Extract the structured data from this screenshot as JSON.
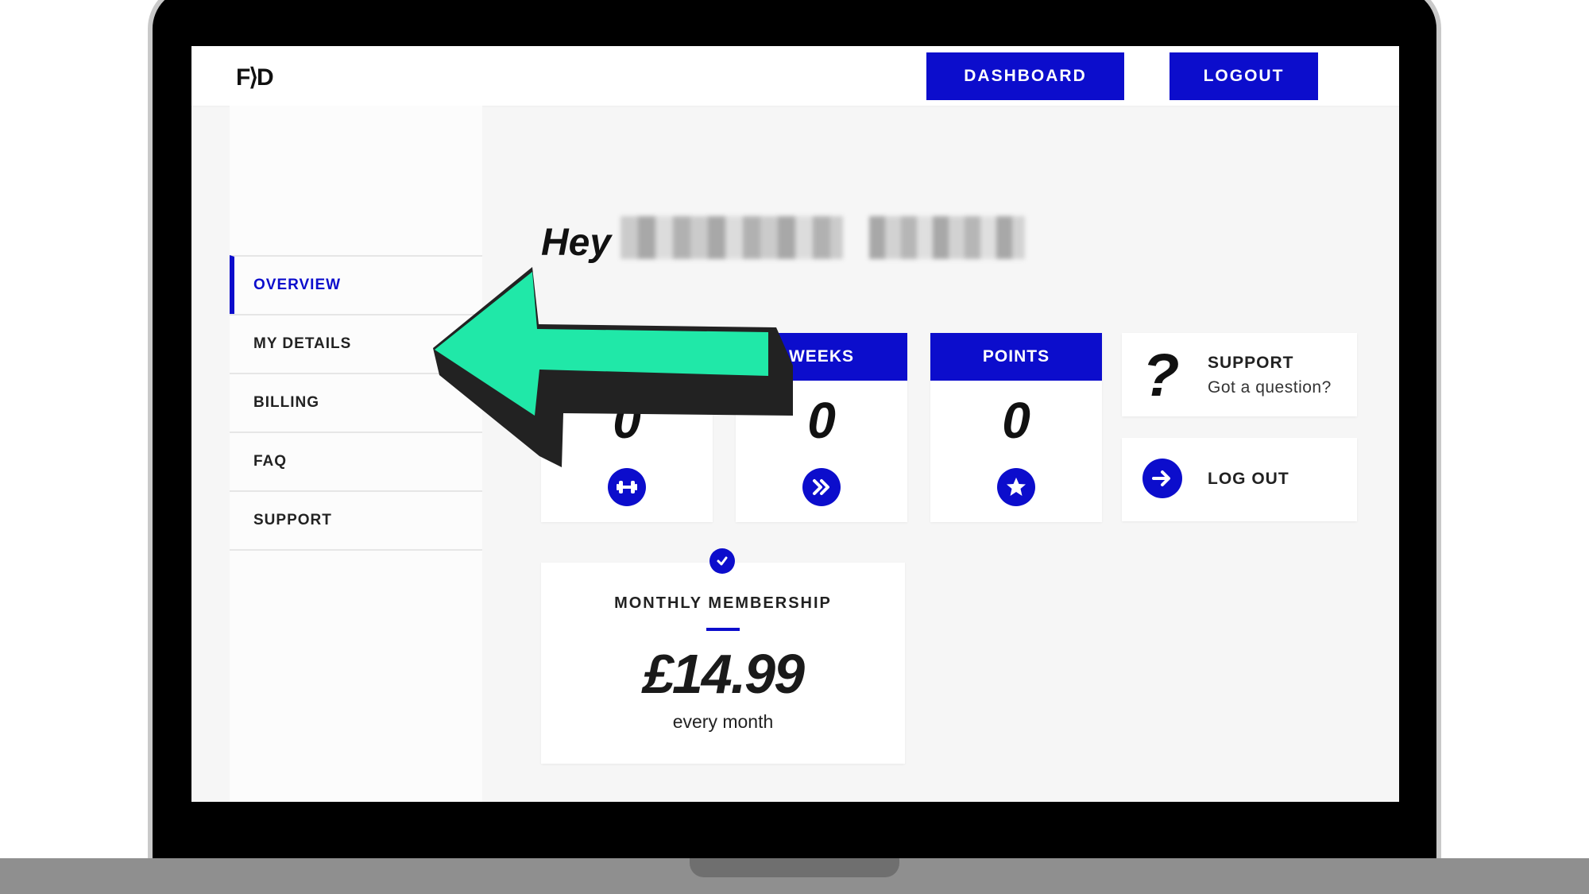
{
  "header": {
    "logo_text": "F⟩D",
    "dashboard_label": "DASHBOARD",
    "logout_label": "LOGOUT"
  },
  "sidebar": {
    "items": [
      {
        "label": "OVERVIEW",
        "active": true
      },
      {
        "label": "MY DETAILS",
        "active": false
      },
      {
        "label": "BILLING",
        "active": false
      },
      {
        "label": "FAQ",
        "active": false
      },
      {
        "label": "SUPPORT",
        "active": false
      }
    ]
  },
  "main": {
    "greeting": "Hey",
    "stats": [
      {
        "label": "",
        "value": "0",
        "icon": "dumbbell-icon"
      },
      {
        "label": "WEEKS",
        "value": "0",
        "icon": "double-chevron-right-icon"
      },
      {
        "label": "POINTS",
        "value": "0",
        "icon": "star-icon"
      }
    ],
    "support_card": {
      "title": "SUPPORT",
      "subtitle": "Got a question?",
      "icon": "question-mark-icon"
    },
    "logout_card": {
      "title": "LOG OUT",
      "icon": "arrow-right-icon"
    },
    "membership": {
      "title": "MONTHLY MEMBERSHIP",
      "price": "£14.99",
      "period": "every month",
      "icon": "check-icon"
    }
  },
  "colors": {
    "accent": "#0c0dcc",
    "arrow_fill": "#20e8a8",
    "background": "#f6f6f6"
  }
}
